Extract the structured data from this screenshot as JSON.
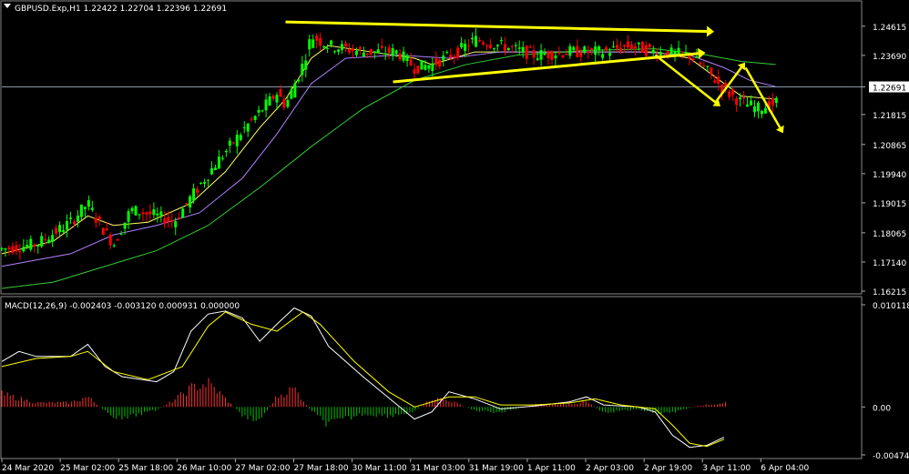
{
  "symbol_header": "GBPUSD.Exp,H1  1.22422 1.22704 1.22396 1.22691",
  "macd_header": "MACD(12,26,9) -0.002403 -0.003120 0.000931 0.000000",
  "colors": {
    "background": "#000000",
    "bull": "#00ff00",
    "bear": "#ff0000",
    "ma_fast": "#ffff66",
    "ma_slow": "#b080ff",
    "ma_long": "#33cc33",
    "macd_line": "#ffffff",
    "signal_line": "#ffff00",
    "hist_pos": "#ff3030",
    "hist_neg": "#00c000",
    "grid": "#555555",
    "arrow": "#ffff00",
    "current_price_label_bg": "#ffffff"
  },
  "chart_data": [
    {
      "type": "candlestick",
      "title": "GBPUSD.Exp,H1",
      "ylim": [
        1.16215,
        1.251
      ],
      "price_ticks": [
        "1.24615",
        "1.23690",
        "1.22691",
        "1.21815",
        "1.20865",
        "1.19940",
        "1.19015",
        "1.18065",
        "1.17140",
        "1.16215"
      ],
      "current_price": "1.22691",
      "time_labels": [
        "24 Mar 2020",
        "25 Mar 02:00",
        "25 Mar 18:00",
        "26 Mar 10:00",
        "27 Mar 02:00",
        "27 Mar 18:00",
        "30 Mar 11:00",
        "31 Mar 03:00",
        "31 Mar 19:00",
        "1 Apr 11:00",
        "2 Apr 03:00",
        "2 Apr 19:00",
        "3 Apr 11:00",
        "6 Apr 04:00"
      ],
      "price_path": [
        [
          0,
          1.1755
        ],
        [
          0.04,
          1.177
        ],
        [
          0.08,
          1.184
        ],
        [
          0.1,
          1.19
        ],
        [
          0.11,
          1.185
        ],
        [
          0.13,
          1.177
        ],
        [
          0.15,
          1.188
        ],
        [
          0.18,
          1.186
        ],
        [
          0.2,
          1.184
        ],
        [
          0.22,
          1.192
        ],
        [
          0.25,
          1.203
        ],
        [
          0.28,
          1.213
        ],
        [
          0.3,
          1.219
        ],
        [
          0.32,
          1.225
        ],
        [
          0.33,
          1.221
        ],
        [
          0.35,
          1.234
        ],
        [
          0.36,
          1.243
        ],
        [
          0.38,
          1.24
        ],
        [
          0.42,
          1.238
        ],
        [
          0.46,
          1.238
        ],
        [
          0.48,
          1.233
        ],
        [
          0.5,
          1.234
        ],
        [
          0.53,
          1.238
        ],
        [
          0.55,
          1.242
        ],
        [
          0.58,
          1.24
        ],
        [
          0.62,
          1.237
        ],
        [
          0.66,
          1.238
        ],
        [
          0.7,
          1.238
        ],
        [
          0.73,
          1.24
        ],
        [
          0.76,
          1.238
        ],
        [
          0.8,
          1.237
        ],
        [
          0.82,
          1.232
        ],
        [
          0.84,
          1.226
        ],
        [
          0.86,
          1.222
        ],
        [
          0.88,
          1.22
        ],
        [
          0.9,
          1.222
        ]
      ],
      "series": [
        {
          "name": "MA fast",
          "path": [
            [
              0,
              1.174
            ],
            [
              0.06,
              1.178
            ],
            [
              0.1,
              1.186
            ],
            [
              0.13,
              1.183
            ],
            [
              0.17,
              1.184
            ],
            [
              0.22,
              1.19
            ],
            [
              0.26,
              1.2
            ],
            [
              0.3,
              1.214
            ],
            [
              0.33,
              1.223
            ],
            [
              0.36,
              1.236
            ],
            [
              0.38,
              1.24
            ],
            [
              0.43,
              1.238
            ],
            [
              0.48,
              1.236
            ],
            [
              0.5,
              1.234
            ],
            [
              0.55,
              1.238
            ],
            [
              0.62,
              1.238
            ],
            [
              0.7,
              1.238
            ],
            [
              0.76,
              1.238
            ],
            [
              0.8,
              1.236
            ],
            [
              0.83,
              1.23
            ],
            [
              0.86,
              1.224
            ],
            [
              0.9,
              1.223
            ]
          ]
        },
        {
          "name": "MA slow",
          "path": [
            [
              0,
              1.17
            ],
            [
              0.08,
              1.174
            ],
            [
              0.13,
              1.18
            ],
            [
              0.18,
              1.183
            ],
            [
              0.23,
              1.187
            ],
            [
              0.28,
              1.198
            ],
            [
              0.32,
              1.212
            ],
            [
              0.36,
              1.228
            ],
            [
              0.4,
              1.236
            ],
            [
              0.46,
              1.237
            ],
            [
              0.52,
              1.236
            ],
            [
              0.58,
              1.238
            ],
            [
              0.66,
              1.238
            ],
            [
              0.74,
              1.238
            ],
            [
              0.8,
              1.237
            ],
            [
              0.84,
              1.233
            ],
            [
              0.87,
              1.229
            ],
            [
              0.9,
              1.227
            ]
          ]
        },
        {
          "name": "MA long",
          "path": [
            [
              0,
              1.163
            ],
            [
              0.06,
              1.165
            ],
            [
              0.12,
              1.17
            ],
            [
              0.18,
              1.175
            ],
            [
              0.24,
              1.183
            ],
            [
              0.3,
              1.195
            ],
            [
              0.36,
              1.208
            ],
            [
              0.42,
              1.22
            ],
            [
              0.48,
              1.229
            ],
            [
              0.54,
              1.234
            ],
            [
              0.6,
              1.237
            ],
            [
              0.68,
              1.2385
            ],
            [
              0.76,
              1.239
            ],
            [
              0.82,
              1.237
            ],
            [
              0.86,
              1.235
            ],
            [
              0.9,
              1.234
            ]
          ]
        }
      ],
      "annotations": {
        "trend_lines": [
          [
            [
              0.33,
              1.2475
            ],
            [
              0.82,
              1.2445
            ]
          ],
          [
            [
              0.455,
              1.2285
            ],
            [
              0.81,
              1.2375
            ]
          ]
        ],
        "arrows": [
          [
            [
              0.76,
              1.237
            ],
            [
              0.83,
              1.222
            ]
          ],
          [
            [
              0.83,
              1.222
            ],
            [
              0.86,
              1.233
            ]
          ],
          [
            [
              0.865,
              1.233
            ],
            [
              0.905,
              1.214
            ]
          ]
        ]
      }
    },
    {
      "type": "macd",
      "title": "MACD(12,26,9)",
      "ylim": [
        -0.004747,
        0.010118
      ],
      "ticks": [
        "0.010118",
        "0.00",
        "-0.004747"
      ],
      "macd_line": [
        [
          0,
          0.0045
        ],
        [
          0.02,
          0.0055
        ],
        [
          0.04,
          0.005
        ],
        [
          0.08,
          0.005
        ],
        [
          0.1,
          0.0062
        ],
        [
          0.12,
          0.004
        ],
        [
          0.14,
          0.003
        ],
        [
          0.18,
          0.0025
        ],
        [
          0.2,
          0.0035
        ],
        [
          0.22,
          0.0075
        ],
        [
          0.24,
          0.0092
        ],
        [
          0.26,
          0.0095
        ],
        [
          0.28,
          0.0088
        ],
        [
          0.3,
          0.0065
        ],
        [
          0.32,
          0.0082
        ],
        [
          0.34,
          0.0098
        ],
        [
          0.36,
          0.009
        ],
        [
          0.38,
          0.006
        ],
        [
          0.42,
          0.003
        ],
        [
          0.46,
          0.0002
        ],
        [
          0.48,
          -0.0012
        ],
        [
          0.5,
          -0.0005
        ],
        [
          0.52,
          0.0015
        ],
        [
          0.55,
          0.0008
        ],
        [
          0.58,
          -0.0002
        ],
        [
          0.62,
          0.0001
        ],
        [
          0.66,
          0.0005
        ],
        [
          0.68,
          0.001
        ],
        [
          0.7,
          0.0002
        ],
        [
          0.74,
          0.0
        ],
        [
          0.76,
          -0.0005
        ],
        [
          0.78,
          -0.0028
        ],
        [
          0.8,
          -0.004
        ],
        [
          0.82,
          -0.0038
        ],
        [
          0.84,
          -0.003
        ]
      ],
      "signal_line": [
        [
          0,
          0.004
        ],
        [
          0.04,
          0.0048
        ],
        [
          0.08,
          0.005
        ],
        [
          0.1,
          0.0055
        ],
        [
          0.13,
          0.0035
        ],
        [
          0.17,
          0.0027
        ],
        [
          0.21,
          0.004
        ],
        [
          0.24,
          0.008
        ],
        [
          0.26,
          0.0094
        ],
        [
          0.29,
          0.0082
        ],
        [
          0.32,
          0.0075
        ],
        [
          0.35,
          0.0094
        ],
        [
          0.37,
          0.0082
        ],
        [
          0.41,
          0.0045
        ],
        [
          0.45,
          0.0015
        ],
        [
          0.48,
          0.0
        ],
        [
          0.52,
          0.001
        ],
        [
          0.55,
          0.001
        ],
        [
          0.58,
          0.0002
        ],
        [
          0.62,
          0.0002
        ],
        [
          0.66,
          0.0004
        ],
        [
          0.69,
          0.0008
        ],
        [
          0.72,
          0.0002
        ],
        [
          0.76,
          -0.0002
        ],
        [
          0.78,
          -0.0018
        ],
        [
          0.8,
          -0.0036
        ],
        [
          0.82,
          -0.0039
        ],
        [
          0.84,
          -0.0032
        ]
      ],
      "histogram": [
        [
          0.0,
          0.0015
        ],
        [
          0.04,
          0.0005
        ],
        [
          0.08,
          0.0005
        ],
        [
          0.1,
          0.0012
        ],
        [
          0.12,
          -0.0005
        ],
        [
          0.14,
          -0.0015
        ],
        [
          0.16,
          -0.0008
        ],
        [
          0.18,
          -0.0004
        ],
        [
          0.2,
          0.0008
        ],
        [
          0.22,
          0.0022
        ],
        [
          0.24,
          0.0028
        ],
        [
          0.26,
          0.001
        ],
        [
          0.28,
          -0.001
        ],
        [
          0.3,
          -0.0015
        ],
        [
          0.32,
          0.0012
        ],
        [
          0.34,
          0.0022
        ],
        [
          0.36,
          -0.0005
        ],
        [
          0.38,
          -0.002
        ],
        [
          0.4,
          -0.0014
        ],
        [
          0.42,
          -0.0008
        ],
        [
          0.45,
          -0.001
        ],
        [
          0.48,
          -0.0006
        ],
        [
          0.5,
          0.001
        ],
        [
          0.52,
          0.0008
        ],
        [
          0.55,
          -0.0004
        ],
        [
          0.58,
          -0.0006
        ],
        [
          0.62,
          0.0003
        ],
        [
          0.66,
          0.0004
        ],
        [
          0.68,
          0.0006
        ],
        [
          0.7,
          -0.0006
        ],
        [
          0.74,
          -0.0003
        ],
        [
          0.77,
          -0.0008
        ],
        [
          0.79,
          -0.0004
        ],
        [
          0.81,
          0.0002
        ],
        [
          0.83,
          0.0003
        ],
        [
          0.845,
          0.0006
        ]
      ]
    }
  ]
}
